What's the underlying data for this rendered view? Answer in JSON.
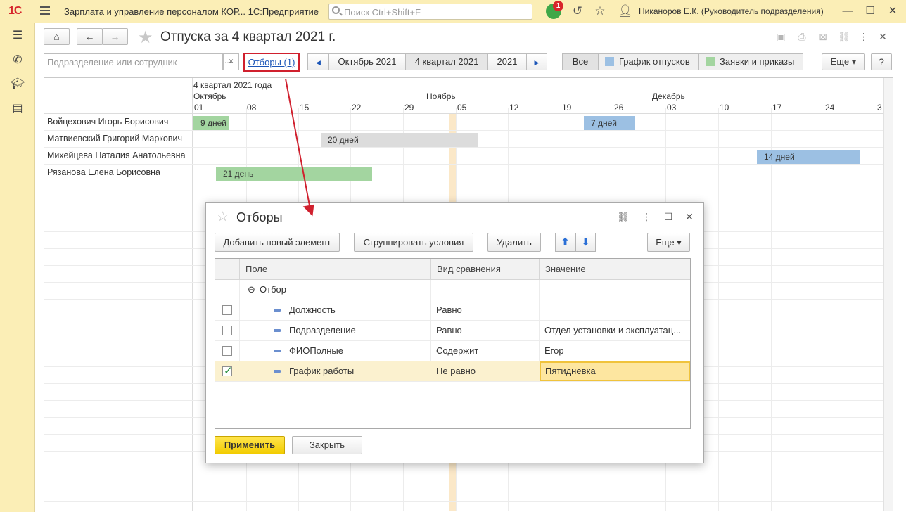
{
  "app": {
    "logo": "1С",
    "title": "Зарплата и управление персоналом КОР...  1С:Предприятие",
    "search_placeholder": "Поиск Ctrl+Shift+F",
    "notif_count": "1",
    "user": "Никаноров Е.К. (Руководитель подразделения)"
  },
  "page": {
    "title": "Отпуска за 4 квартал 2021 г.",
    "filter_placeholder": "Подразделение или сотрудник",
    "filter_dots": "...",
    "filter_clear": "×",
    "filters_link": "Отборы (1)",
    "periods": [
      "Октябрь 2021",
      "4 квартал 2021",
      "2021"
    ],
    "selected_period": "4 квартал 2021",
    "legend": {
      "all": "Все",
      "schedule": "График отпусков",
      "orders": "Заявки и приказы",
      "schedule_color": "#9cc0e3",
      "orders_color": "#a3d5a0"
    },
    "more": "Еще",
    "help": "?"
  },
  "gantt": {
    "quarter_label": "4 квартал 2021 года",
    "months": [
      "Октябрь",
      "Ноябрь",
      "Декабрь"
    ],
    "days": [
      "01",
      "08",
      "15",
      "22",
      "29",
      "05",
      "12",
      "19",
      "26",
      "03",
      "10",
      "17",
      "24",
      "3"
    ],
    "employees": [
      "Войцехович Игорь Борисович",
      "Матвиевский Григорий Маркович",
      "Михейцева Наталия Анатольевна",
      "Рязанова Елена Борисовна"
    ],
    "bars": [
      {
        "row": 0,
        "label": "9 дней",
        "kind": "order"
      },
      {
        "row": 0,
        "label": "7 дней",
        "kind": "schedule"
      },
      {
        "row": 1,
        "label": "20 дней",
        "kind": "other"
      },
      {
        "row": 2,
        "label": "14 дней",
        "kind": "schedule"
      },
      {
        "row": 3,
        "label": "21 день",
        "kind": "order"
      }
    ],
    "colors": {
      "order": "#a3d5a0",
      "schedule": "#9cc0e3",
      "other": "#dcdcdc",
      "today": "#fbe8c8"
    }
  },
  "dialog": {
    "title": "Отборы",
    "buttons": {
      "add": "Добавить новый элемент",
      "group": "Сгруппировать условия",
      "delete": "Удалить",
      "more": "Еще",
      "apply": "Применить",
      "close": "Закрыть"
    },
    "columns": [
      "Поле",
      "Вид сравнения",
      "Значение"
    ],
    "group_label": "Отбор",
    "rows": [
      {
        "field": "Должность",
        "comparison": "Равно",
        "value": "",
        "checked": false
      },
      {
        "field": "Подразделение",
        "comparison": "Равно",
        "value": "Отдел установки и эксплуатац...",
        "checked": false
      },
      {
        "field": "ФИОПолные",
        "comparison": "Содержит",
        "value": "Егор",
        "checked": false
      },
      {
        "field": "График работы",
        "comparison": "Не равно",
        "value": "Пятидневка",
        "checked": true
      }
    ]
  }
}
